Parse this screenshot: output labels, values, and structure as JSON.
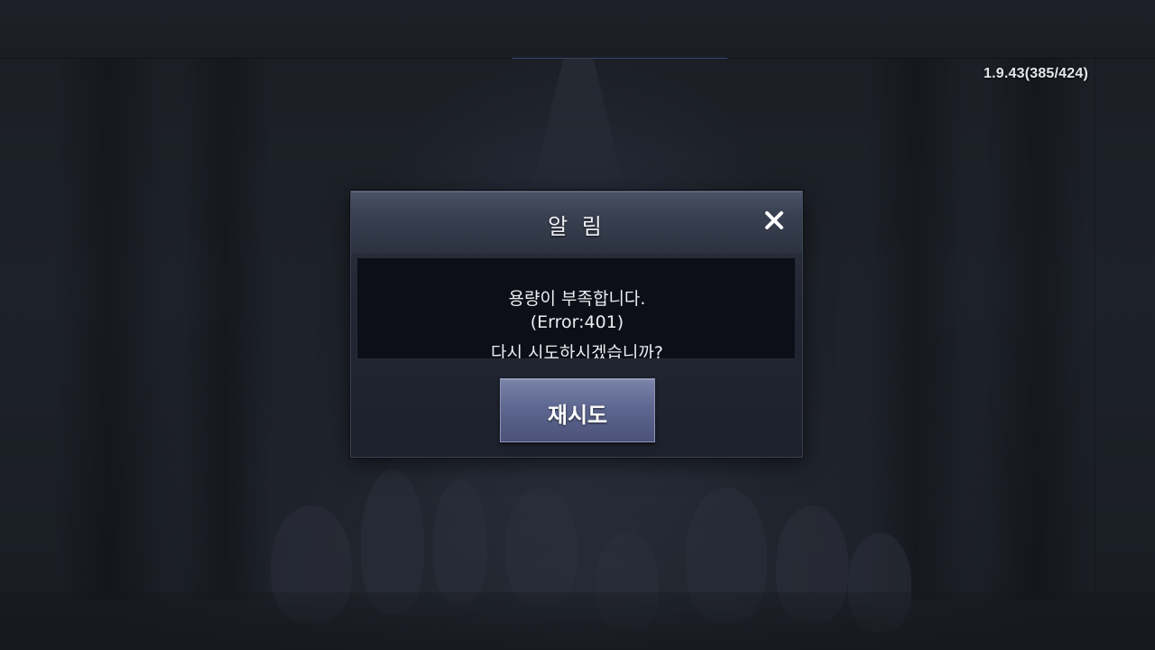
{
  "app": {
    "version": "1.9.43(385/424)"
  },
  "dialog": {
    "title": "알 림",
    "close_icon": "close-x-icon",
    "message": {
      "line1": "용량이 부족합니다.",
      "line2": "(Error:401)",
      "line3": "다시 시도하시겠습니까?"
    },
    "retry_label": "재시도"
  },
  "colors": {
    "accent_button": "#5e6790",
    "dialog_header": "#3a4152",
    "message_background": "#0c0f18"
  }
}
